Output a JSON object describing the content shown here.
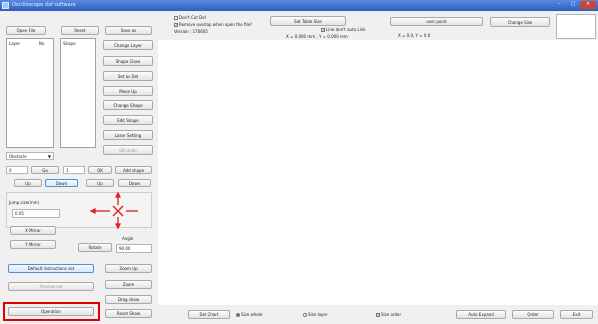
{
  "window": {
    "title": "Oscilloscope dxf software",
    "min": "–",
    "max": "□",
    "close": "✕"
  },
  "left": {
    "open_file": "Open File",
    "reset": "Reset",
    "save_as": "Save as",
    "col_layer": "Layer",
    "col_no": "No",
    "col_shape": "Shape",
    "change_layer": "Change Layer",
    "shape_close": "Shape Close",
    "set_as_del": "Set as Del",
    "move_up": "Move Up",
    "change_shape": "Change Shape",
    "edit_shape": "Edit Shape",
    "laser_setting": "Laser Setting",
    "ok_disabled": "OK Undo",
    "mode_select": "Obstacle",
    "zero_field": "0",
    "go_btn": "Go",
    "one_field": "1",
    "ok_btn": "OK",
    "add_shape": "Add shape",
    "btn_up1": "Up",
    "btn_down1": "Down",
    "btn_up2": "Up",
    "btn_down2": "Down",
    "jump_label": "Jump size(mm)",
    "jump_value": "0.05",
    "x_mirror": "X Mirror",
    "y_mirror": "Y Mirror",
    "rotate": "Rotate",
    "angle_label": "Angle",
    "angle_value": "90.00",
    "default_instructions": "Default instructions set",
    "preview": "Preview set",
    "operation": "Operation",
    "zoom_up": "Zoom Up",
    "zoom": "Zoom",
    "drag_show": "Drag show",
    "reset_show": "Reset Show"
  },
  "top": {
    "dont_cut_del": "Don't Cut Del",
    "remove_overlap": "Remove overlap when open the file?",
    "version": "Version : 170605",
    "set_table_size": "Set Table Size",
    "line_dont_auto_link": "Line don't auto Link",
    "coords1": "X = 0.000 mm , Y = 0.000 mm",
    "user_point": "user point",
    "coords2": "X = 0.0, Y = 0.0",
    "change_size": "Change Size"
  },
  "bottom": {
    "del_chart": "Del Chart",
    "size_whole": "Size whole",
    "size_layer": "Size layer",
    "size_order": "Size order",
    "auto_expand": "Auto Expand",
    "order": "Order",
    "exit": "Exit"
  },
  "colors": {
    "titlebar": "#2b5fbf",
    "cross": "#e02020",
    "highlight": "#e00000"
  }
}
